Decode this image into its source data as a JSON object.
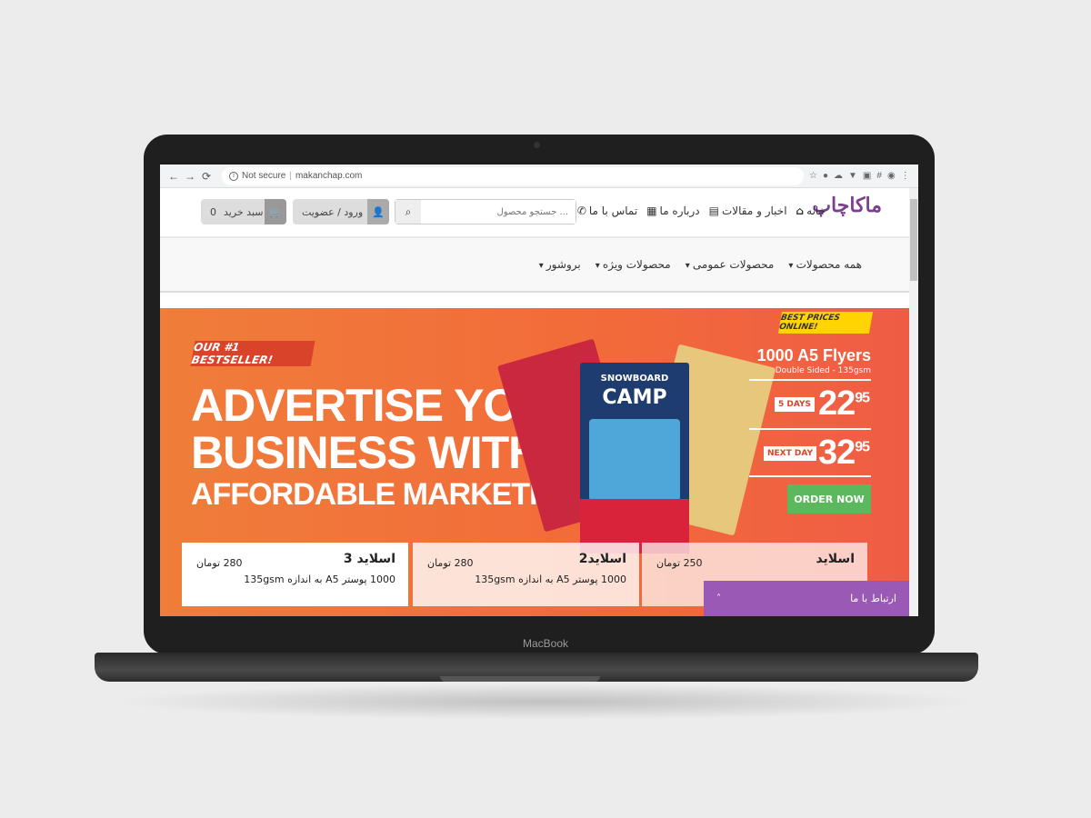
{
  "device": {
    "brand": "MacBook"
  },
  "browser": {
    "back": "←",
    "forward": "→",
    "reload": "⟳",
    "security": "Not secure",
    "url": "makanchap.com",
    "extensions": [
      "☆",
      "●",
      "☁",
      "▼",
      "▣",
      "#",
      "◉",
      "⋮"
    ]
  },
  "header": {
    "logo": "ماکاچاپ",
    "links": [
      {
        "label": "خانه",
        "icon": "home-icon"
      },
      {
        "label": "اخبار و مقالات",
        "icon": "news-icon"
      },
      {
        "label": "درباره ما",
        "icon": "about-icon"
      },
      {
        "label": "تماس با ما",
        "icon": "phone-icon"
      }
    ],
    "search_placeholder": "جستجو محصول ...",
    "login_label": "ورود / عضویت",
    "cart_label": "سبد خرید",
    "cart_count": "0"
  },
  "menu": {
    "items": [
      "همه محصولات",
      "محصولات عمومی",
      "محصولات ویژه",
      "بروشور"
    ]
  },
  "hero": {
    "badge": "OUR #1 BESTSELLER!",
    "line1": "ADVERTISE YOUR",
    "line2": "BUSINESS WITH",
    "line3": "AFFORDABLE MARKETING!",
    "best_prices": "BEST PRICES ONLINE!",
    "product": "1000 A5 Flyers",
    "product_sub": "Double Sided - 135gsm",
    "opt1_label": "5 DAYS",
    "opt1_price": "22",
    "opt1_cents": "95",
    "opt2_label": "NEXT DAY",
    "opt2_price": "32",
    "opt2_cents": "95",
    "order": "ORDER NOW",
    "flyer_title": "SNOWBOARD",
    "flyer_main": "CAMP"
  },
  "slides": [
    {
      "title": "اسلاید 3",
      "price": "280 تومان",
      "desc": "1000 پوستر A5 به اندازه 135gsm"
    },
    {
      "title": "اسلاید2",
      "price": "280 تومان",
      "desc": "1000 پوستر A5 به اندازه 135gsm"
    },
    {
      "title": "اسلاید",
      "price": "250 تومان",
      "desc": ""
    }
  ],
  "contact": {
    "label": "ارتباط با ما",
    "chevron": "˄"
  }
}
